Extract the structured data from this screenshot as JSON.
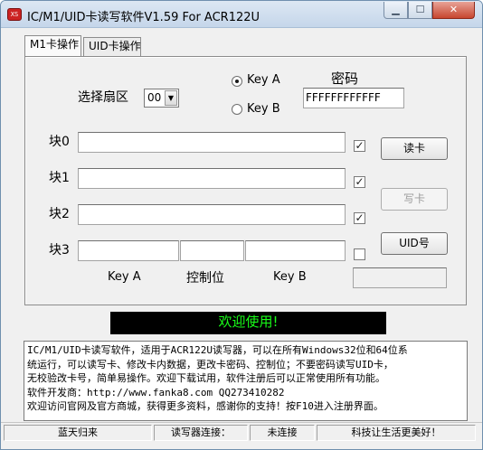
{
  "window": {
    "title": "IC/M1/UID卡读写软件V1.59 For ACR122U",
    "icon_text": "XS",
    "min_glyph": "▁",
    "max_glyph": "☐",
    "close_glyph": "✕"
  },
  "tabs": [
    {
      "label": "M1卡操作",
      "active": true
    },
    {
      "label": "UID卡操作",
      "active": false
    }
  ],
  "sector": {
    "label": "选择扇区",
    "value": "00"
  },
  "key_select": {
    "key_a": "Key A",
    "key_b": "Key B",
    "selected": "Key A"
  },
  "password": {
    "label": "密码",
    "value": "FFFFFFFFFFFF"
  },
  "blocks": [
    {
      "label": "块0",
      "value": "",
      "checked": true
    },
    {
      "label": "块1",
      "value": "",
      "checked": true
    },
    {
      "label": "块2",
      "value": "",
      "checked": true
    },
    {
      "label": "块3",
      "key_a": "",
      "access": "",
      "key_b": "",
      "checked": false
    }
  ],
  "block3_labels": {
    "key_a": "Key A",
    "access": "控制位",
    "key_b": "Key B"
  },
  "buttons": {
    "read": "读卡",
    "write": "写卡",
    "uid": "UID号"
  },
  "uid_value": "",
  "check_mark": "✓",
  "banner": "欢迎使用!",
  "info_lines": [
    "IC/M1/UID卡读写软件，适用于ACR122U读写器，可以在所有Windows32位和64位系",
    "统运行，可以读写卡、修改卡内数据，更改卡密码、控制位；不要密码读写UID卡，",
    "无校验改卡号，简单易操作。欢迎下载试用，软件注册后可以正常使用所有功能。",
    "软件开发商：http://www.fanka8.com QQ273410282",
    "欢迎访问官网及官方商城，获得更多资料，感谢你的支持！按F10进入注册界面。"
  ],
  "status": {
    "brand": "蓝天归来",
    "reader_label": "读写器连接：",
    "reader_state": "未连接",
    "slogan": "科技让生活更美好！"
  },
  "colors": {
    "banner_bg": "#000000",
    "banner_text": "#19ff19"
  }
}
